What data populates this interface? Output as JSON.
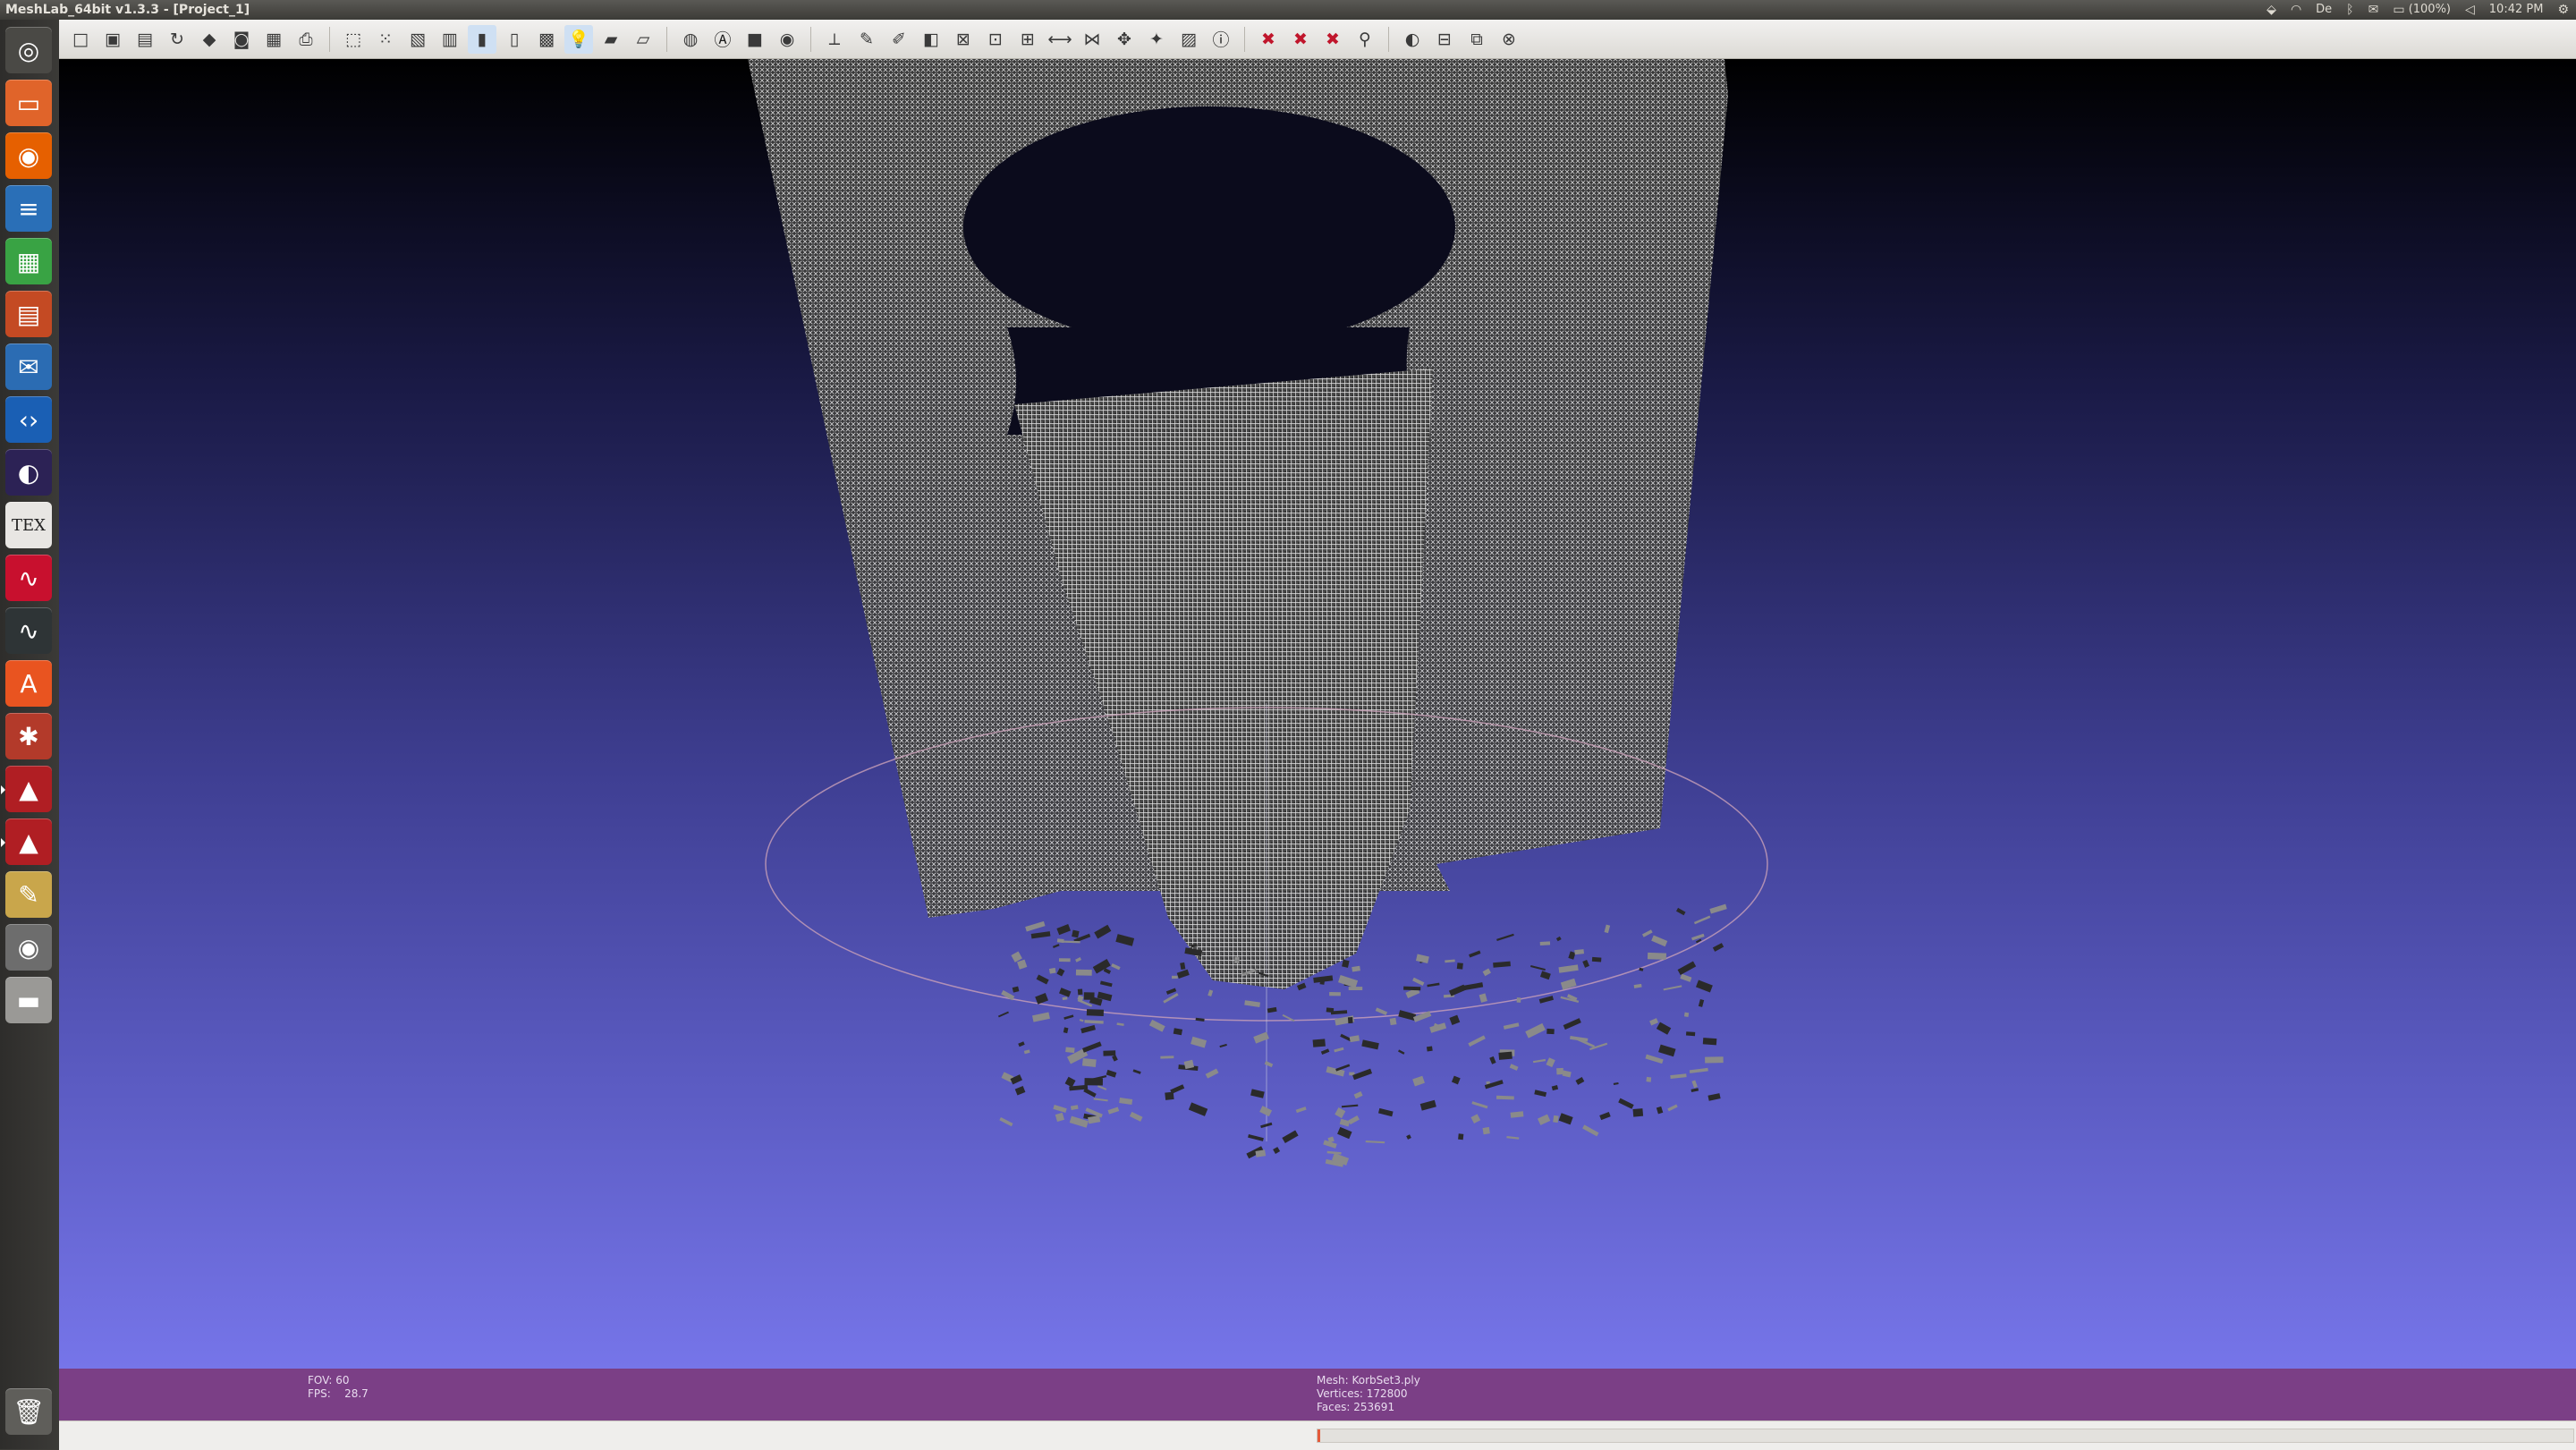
{
  "window": {
    "title": "MeshLab_64bit v1.3.3 - [Project_1]"
  },
  "system_tray": {
    "dropbox_icon": "dropbox-icon",
    "wifi_icon": "wifi-icon",
    "keyboard_layout": "De",
    "bluetooth_icon": "bluetooth-icon",
    "mail_icon": "mail-icon",
    "battery": "(100%)",
    "volume_icon": "volume-icon",
    "clock": "10:42 PM",
    "settings_icon": "gear-icon"
  },
  "toolbar": {
    "buttons": [
      {
        "name": "new-project-icon",
        "glyph": "□"
      },
      {
        "name": "open-project-icon",
        "glyph": "▣"
      },
      {
        "name": "open-mesh-icon",
        "glyph": "▤"
      },
      {
        "name": "reload-icon",
        "glyph": "↻"
      },
      {
        "name": "save-icon",
        "glyph": "◆"
      },
      {
        "name": "snapshot-icon",
        "glyph": "◙"
      },
      {
        "name": "export-icon",
        "glyph": "▦"
      },
      {
        "name": "print-icon",
        "glyph": "⎙"
      },
      {
        "name": "bounding-box-icon",
        "glyph": "⬚"
      },
      {
        "name": "points-icon",
        "glyph": "⁙"
      },
      {
        "name": "wireframe-icon",
        "glyph": "▧"
      },
      {
        "name": "hidden-lines-icon",
        "glyph": "▥"
      },
      {
        "name": "flat-shading-icon",
        "glyph": "▮"
      },
      {
        "name": "smooth-shading-icon",
        "glyph": "▯"
      },
      {
        "name": "texture-icon",
        "glyph": "▩"
      },
      {
        "name": "light-bulb-icon",
        "glyph": "💡"
      },
      {
        "name": "double-side-lighting-icon",
        "glyph": "▰"
      },
      {
        "name": "fancy-lighting-icon",
        "glyph": "▱"
      },
      {
        "name": "back-face-culling-icon",
        "glyph": "◍"
      },
      {
        "name": "annotation-icon",
        "glyph": "Ⓐ"
      },
      {
        "name": "color-icon",
        "glyph": "■"
      },
      {
        "name": "globe-icon",
        "glyph": "◉"
      },
      {
        "name": "axes-icon",
        "glyph": "⟂"
      },
      {
        "name": "paint-icon",
        "glyph": "✎"
      },
      {
        "name": "brush-icon",
        "glyph": "✐"
      },
      {
        "name": "pick-icon",
        "glyph": "◧"
      },
      {
        "name": "select-faces-icon",
        "glyph": "⊠"
      },
      {
        "name": "select-vertices-icon",
        "glyph": "⊡"
      },
      {
        "name": "select-connected-icon",
        "glyph": "⊞"
      },
      {
        "name": "measure-icon",
        "glyph": "⟷"
      },
      {
        "name": "align-icon",
        "glyph": "⋈"
      },
      {
        "name": "manipulator-icon",
        "glyph": "✥"
      },
      {
        "name": "point-picker-icon",
        "glyph": "✦"
      },
      {
        "name": "raster-icon",
        "glyph": "▨"
      },
      {
        "name": "info-icon",
        "glyph": "ⓘ"
      },
      {
        "name": "delete-faces-icon",
        "glyph": "✖"
      },
      {
        "name": "delete-vertices-icon",
        "glyph": "✖"
      },
      {
        "name": "delete-selection-icon",
        "glyph": "✖"
      },
      {
        "name": "search-icon",
        "glyph": "⚲"
      },
      {
        "name": "window-controls-icon",
        "glyph": "◐"
      },
      {
        "name": "minimize-icon",
        "glyph": "⊟"
      },
      {
        "name": "restore-icon",
        "glyph": "⧉"
      },
      {
        "name": "close-icon",
        "glyph": "⊗"
      }
    ]
  },
  "launcher": {
    "items": [
      {
        "name": "dash-icon",
        "glyph": "◎",
        "color": "#4a4945"
      },
      {
        "name": "files-icon",
        "glyph": "▭",
        "color": "#e0642a"
      },
      {
        "name": "firefox-icon",
        "glyph": "◉",
        "color": "#e66000"
      },
      {
        "name": "writer-icon",
        "glyph": "≡",
        "color": "#2a6fb7"
      },
      {
        "name": "calc-icon",
        "glyph": "▦",
        "color": "#39a344"
      },
      {
        "name": "impress-icon",
        "glyph": "▤",
        "color": "#c44a23"
      },
      {
        "name": "thunderbird-icon",
        "glyph": "✉",
        "color": "#2b6cb3"
      },
      {
        "name": "code-editor-icon",
        "glyph": "‹›",
        "color": "#1a5fb4"
      },
      {
        "name": "eclipse-icon",
        "glyph": "◐",
        "color": "#2c2255"
      },
      {
        "name": "tex-icon",
        "glyph": "TEX",
        "color": "#e8e6e3"
      },
      {
        "name": "mendeley-icon",
        "glyph": "∿",
        "color": "#c8102e"
      },
      {
        "name": "system-monitor-icon",
        "glyph": "∿",
        "color": "#2e3436"
      },
      {
        "name": "software-center-icon",
        "glyph": "A",
        "color": "#e95420"
      },
      {
        "name": "system-settings-icon",
        "glyph": "✱",
        "color": "#b33a2a"
      },
      {
        "name": "meshlab-icon",
        "glyph": "▲",
        "color": "#b01e23"
      },
      {
        "name": "meshlab-server-icon",
        "glyph": "▲",
        "color": "#b01e23"
      },
      {
        "name": "text-editor-icon",
        "glyph": "✎",
        "color": "#c9a64b"
      },
      {
        "name": "eye-icon",
        "glyph": "◉",
        "color": "#6d6d6d"
      },
      {
        "name": "drive-icon",
        "glyph": "▬",
        "color": "#9a9996"
      },
      {
        "name": "trash-icon",
        "glyph": "🗑",
        "color": "#5f5e5a"
      }
    ]
  },
  "viewport": {
    "fov_label": "FOV:",
    "fov_value": "60",
    "fps_label": "FPS:",
    "fps_value": "28.7",
    "mesh_label": "Mesh:",
    "mesh_name": "KorbSet3.ply",
    "vertices_label": "Vertices:",
    "vertices_value": "172800",
    "faces_label": "Faces:",
    "faces_value": "253691"
  },
  "colors": {
    "info_bar": "#7b3f86",
    "progress_fill": "#e45a3a"
  },
  "progress": {
    "fraction": 0.001
  }
}
